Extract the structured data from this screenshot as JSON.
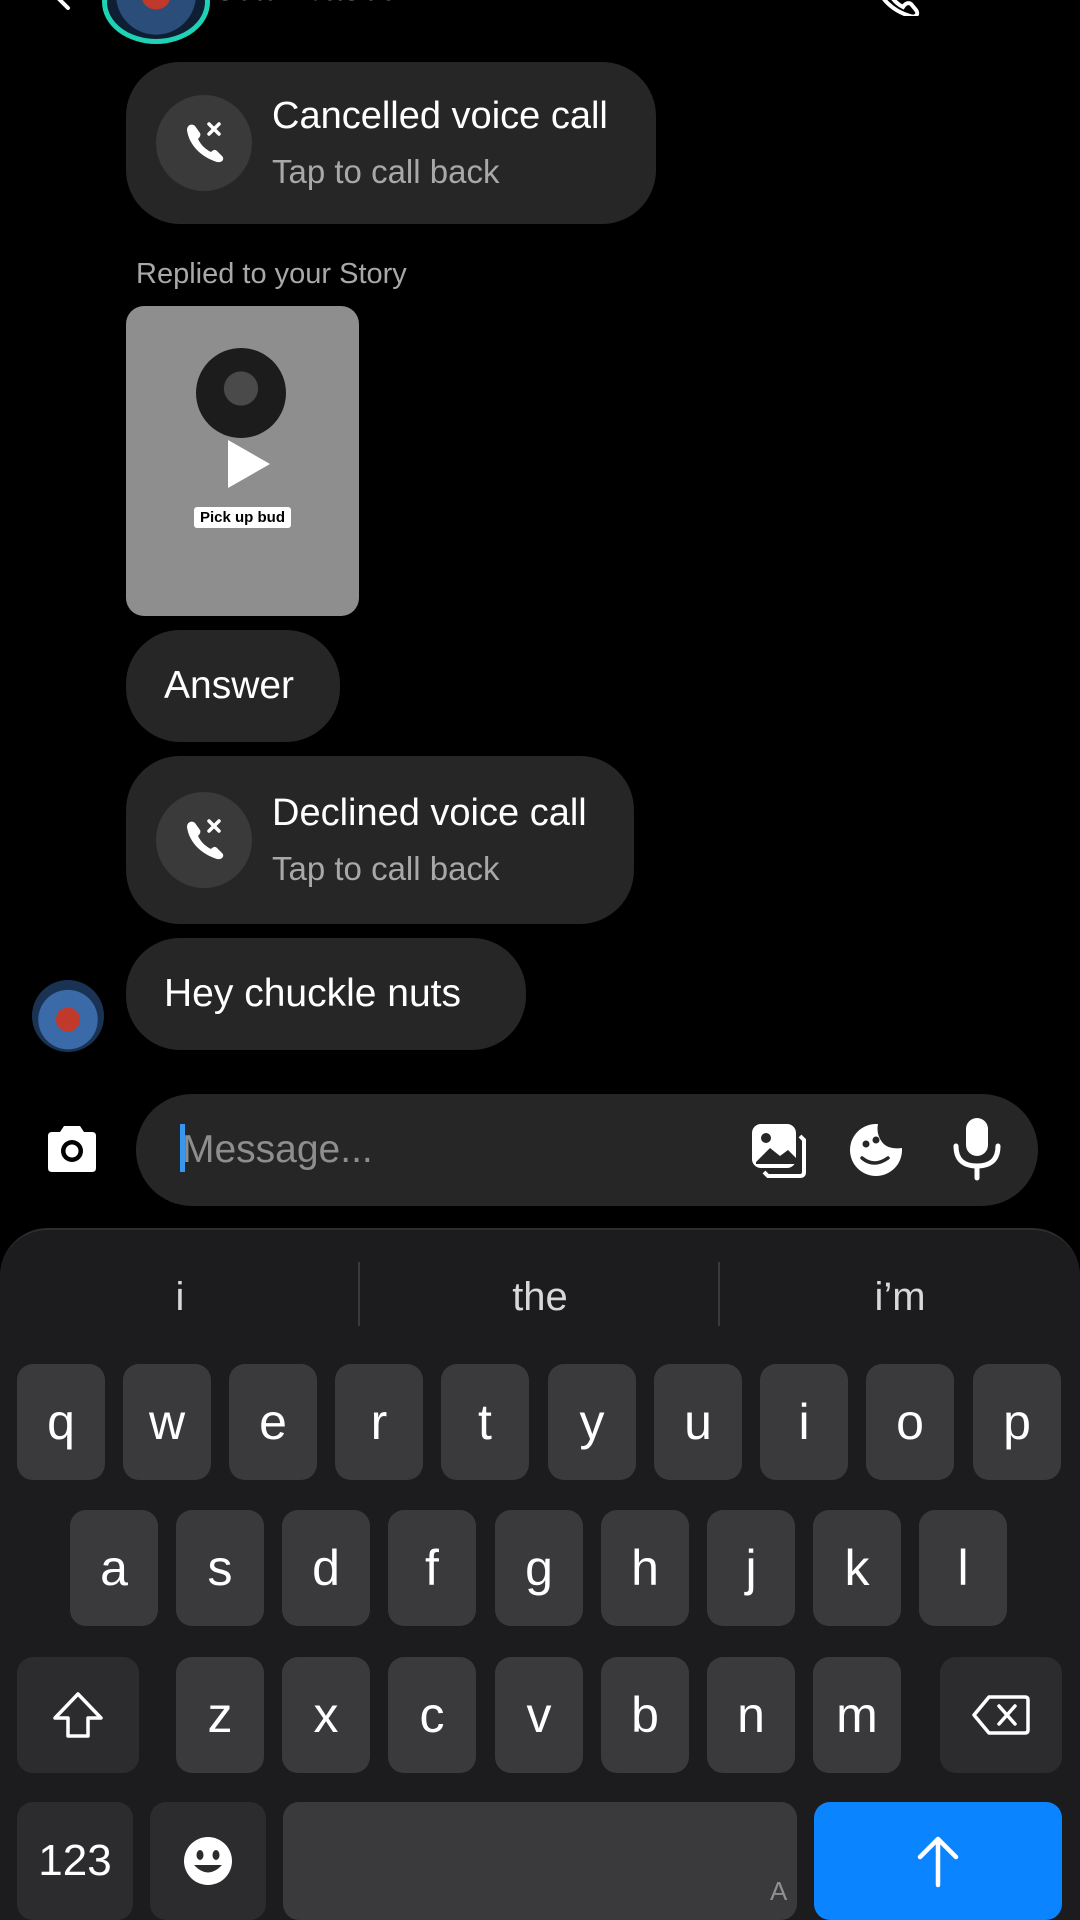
{
  "header": {
    "name": "sean.based"
  },
  "messages": {
    "cancelled_call": {
      "title": "Cancelled voice call",
      "subtitle": "Tap to call back"
    },
    "story_reply_label": "Replied to your Story",
    "story_caption": "Pick up bud",
    "answer": "Answer",
    "declined_call": {
      "title": "Declined voice call",
      "subtitle": "Tap to call back"
    },
    "last_message": "Hey chuckle nuts"
  },
  "composer": {
    "placeholder": "Message..."
  },
  "keyboard": {
    "suggestions": [
      "i",
      "the",
      "i’m"
    ],
    "row1": [
      "q",
      "w",
      "e",
      "r",
      "t",
      "y",
      "u",
      "i",
      "o",
      "p"
    ],
    "row2": [
      "a",
      "s",
      "d",
      "f",
      "g",
      "h",
      "j",
      "k",
      "l"
    ],
    "row3": [
      "z",
      "x",
      "c",
      "v",
      "b",
      "n",
      "m"
    ],
    "numbers_key": "123",
    "space_hint": "A"
  },
  "colors": {
    "accent": "#0a84ff",
    "bubble": "#262626",
    "ring": "#1fd1b5"
  }
}
